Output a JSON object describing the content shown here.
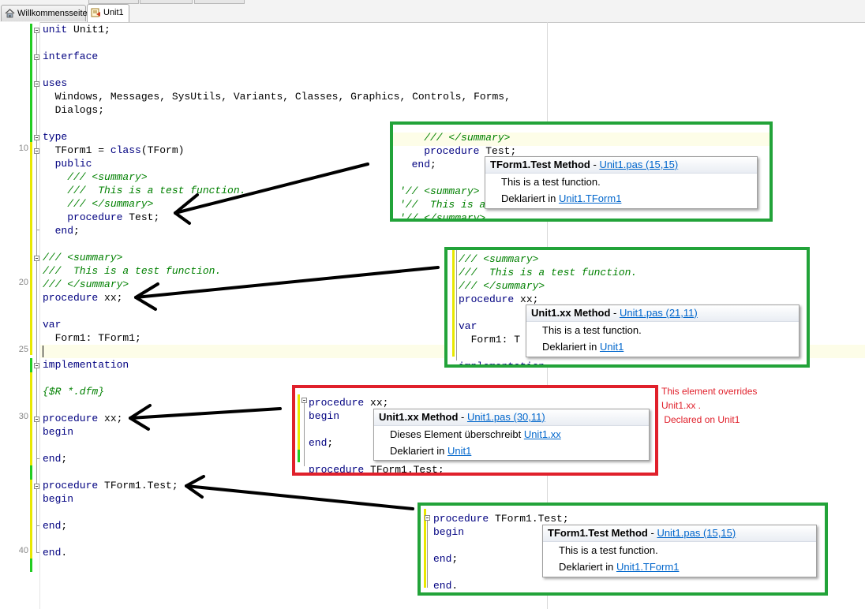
{
  "tabs": [
    {
      "label": "Willkommensseite",
      "icon": "house-icon"
    },
    {
      "label": "Unit1",
      "icon": "unit-file-icon"
    }
  ],
  "gutter": {
    "line_numbers": [
      "10",
      "20",
      "25",
      "30",
      "40"
    ]
  },
  "editor": {
    "lines": [
      "unit Unit1;",
      "",
      "interface",
      "",
      "uses",
      "  Windows, Messages, SysUtils, Variants, Classes, Graphics, Controls, Forms,",
      "  Dialogs;",
      "",
      "type",
      "  TForm1 = class(TForm)",
      "  public",
      "    /// <summary>",
      "    ///  This is a test function.",
      "    /// </summary>",
      "    procedure Test;",
      "  end;",
      "",
      "/// <summary>",
      "///  This is a test function.",
      "/// </summary>",
      "procedure xx;",
      "",
      "var",
      "  Form1: TForm1;",
      "",
      "implementation",
      "",
      "{$R *.dfm}",
      "",
      "procedure xx;",
      "begin",
      "",
      "end;",
      "",
      "procedure TForm1.Test;",
      "begin",
      "",
      "end;",
      "",
      "end."
    ]
  },
  "callouts": [
    {
      "code": [
        "    /// </summary>",
        "    procedure Test;",
        "  end;",
        "",
        "'// <summary>",
        "'//  This is a",
        "'// </summary>"
      ],
      "tip": {
        "title": "TForm1.Test Method",
        "sep": " - ",
        "link": "Unit1.pas (15,15)",
        "desc": "This is a test function.",
        "decl_prefix": "Deklariert in ",
        "decl_link": "Unit1.TForm1"
      }
    },
    {
      "code": [
        "/// <summary>",
        "///  This is a test function.",
        "/// </summary>",
        "procedure xx;",
        "",
        "var",
        "  Form1: T",
        "",
        "implementation"
      ],
      "tip": {
        "title": "Unit1.xx Method",
        "sep": " - ",
        "link": "Unit1.pas (21,11)",
        "desc": "This is a test function.",
        "decl_prefix": "Deklariert in ",
        "decl_link": "Unit1"
      }
    },
    {
      "code": [
        "procedure xx;",
        "begin",
        "",
        "end;",
        "",
        "procedure TForm1.Test;"
      ],
      "tip": {
        "title": "Unit1.xx Method",
        "sep": " - ",
        "link": "Unit1.pas (30,11)",
        "desc_prefix": "Dieses Element überschreibt ",
        "desc_link": "Unit1.xx",
        "decl_prefix": "Deklariert in ",
        "decl_link": "Unit1"
      }
    },
    {
      "code": [
        "procedure TForm1.Test;",
        "begin",
        "",
        "end;",
        "",
        "end."
      ],
      "tip": {
        "title": "TForm1.Test Method",
        "sep": " - ",
        "link": "Unit1.pas (15,15)",
        "desc": "This is a test function.",
        "decl_prefix": "Deklariert in ",
        "decl_link": "Unit1.TForm1"
      }
    }
  ],
  "note": {
    "text": "This element overrides\nUnit1.xx .\n Declared on Unit1"
  },
  "colors": {
    "green_frame": "#22a339",
    "red_frame": "#e0202b",
    "keyword": "#000080",
    "comment": "#008000",
    "link": "#0066cc",
    "modified_bar": "#e8e800",
    "saved_bar": "#22cc22"
  }
}
